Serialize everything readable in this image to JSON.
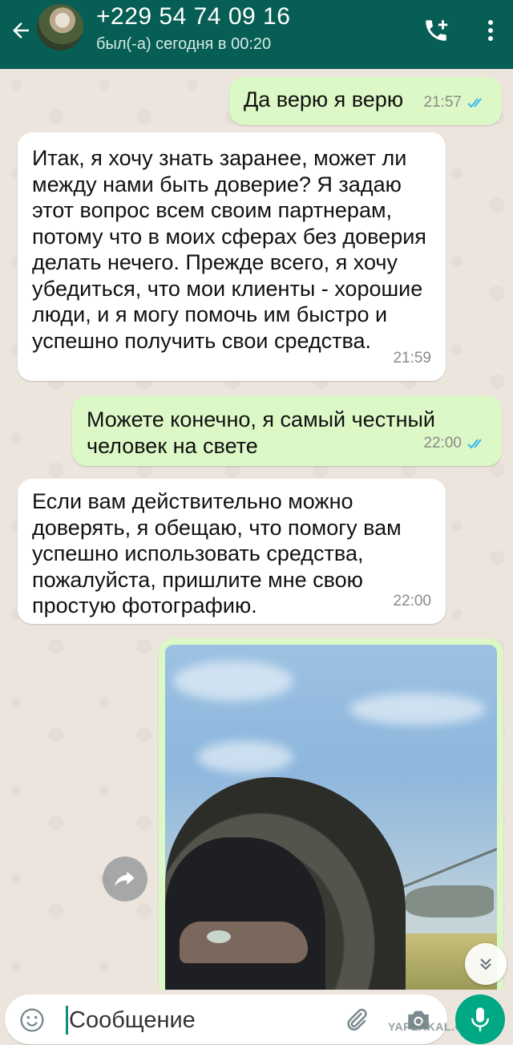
{
  "header": {
    "contact_name": "+229 54 74 09 16",
    "status": "был(-а) сегодня в 00:20",
    "icons": [
      "back-arrow-icon",
      "add-call-icon",
      "more-vert-icon"
    ],
    "background_color": "#075e54"
  },
  "messages": [
    {
      "direction": "outgoing",
      "text": "Да верю я верю",
      "time": "21:57",
      "status": "read"
    },
    {
      "direction": "incoming",
      "text": "Итак, я хочу знать заранее, может ли\nмежду нами быть доверие?  Я задаю\nэтот вопрос всем своим партнерам,\nпотому что в моих сферах без доверия\nделать нечего.  Прежде всего, я хочу\nубедиться, что мои клиенты - хорошие\nлюди, и я могу помочь им быстро и\nуспешно получить свои средства.",
      "time": "21:59"
    },
    {
      "direction": "outgoing",
      "text": "Можете конечно, я самый честный\nчеловек на свете",
      "time": "22:00",
      "status": "read"
    },
    {
      "direction": "incoming",
      "text": "Если вам действительно можно\nдоверять, я обещаю, что помогу вам\nуспешно использовать средства,\nпожалуйста, пришлите мне свою\nпростую фотографию.",
      "time": "22:00"
    },
    {
      "direction": "outgoing",
      "type": "photo",
      "subject": "selfie-photo"
    }
  ],
  "input": {
    "placeholder": "Сообщение",
    "value": ""
  },
  "watermark": "YAPLAKAL.COM",
  "colors": {
    "outgoing_bubble": "#dcf8c6",
    "incoming_bubble": "#ffffff",
    "chat_background": "#ece5dd",
    "read_tick": "#34b7f1",
    "accent": "#00a884"
  }
}
